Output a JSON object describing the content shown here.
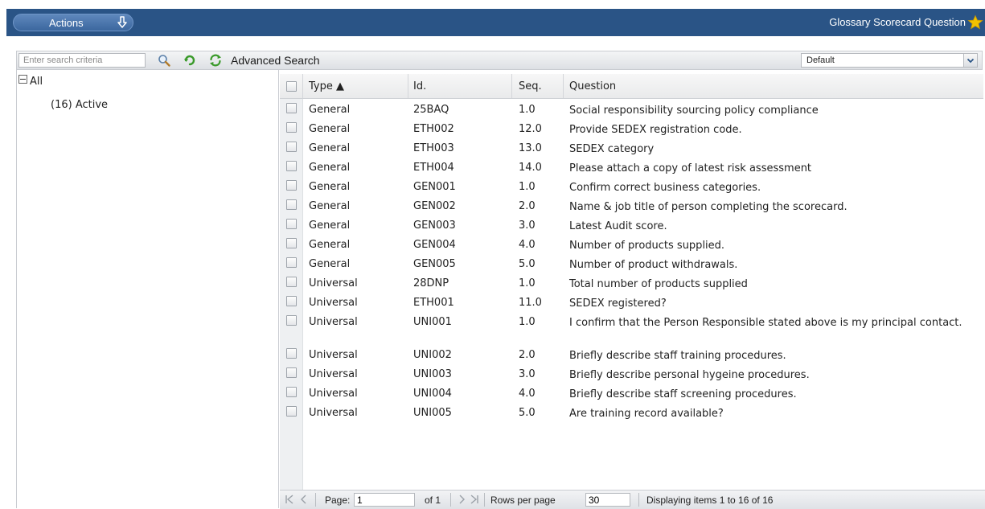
{
  "topbar": {
    "actions_label": "Actions",
    "title": "Glossary Scorecard Question"
  },
  "toolbar": {
    "search_placeholder": "Enter search criteria",
    "advanced_search_label": "Advanced Search",
    "view_selected": "Default"
  },
  "tree": {
    "root_label": "All",
    "active_label": "(16) Active"
  },
  "grid": {
    "headers": {
      "type": "Type ▲",
      "id": "Id.",
      "seq": "Seq.",
      "question": "Question"
    },
    "rows": [
      {
        "type": "General",
        "id": "25BAQ",
        "seq": "1.0",
        "question": "Social responsibility sourcing policy compliance"
      },
      {
        "type": "General",
        "id": "ETH002",
        "seq": "12.0",
        "question": "Provide SEDEX registration code."
      },
      {
        "type": "General",
        "id": "ETH003",
        "seq": "13.0",
        "question": "SEDEX category"
      },
      {
        "type": "General",
        "id": "ETH004",
        "seq": "14.0",
        "question": "Please attach a copy of latest risk assessment"
      },
      {
        "type": "General",
        "id": "GEN001",
        "seq": "1.0",
        "question": "Confirm correct business categories."
      },
      {
        "type": "General",
        "id": "GEN002",
        "seq": "2.0",
        "question": "Name & job title of person completing the scorecard."
      },
      {
        "type": "General",
        "id": "GEN003",
        "seq": "3.0",
        "question": "Latest Audit score."
      },
      {
        "type": "General",
        "id": "GEN004",
        "seq": "4.0",
        "question": "Number of products supplied."
      },
      {
        "type": "General",
        "id": "GEN005",
        "seq": "5.0",
        "question": "Number of product withdrawals."
      },
      {
        "type": "Universal",
        "id": "28DNP",
        "seq": "1.0",
        "question": "Total number of products supplied"
      },
      {
        "type": "Universal",
        "id": "ETH001",
        "seq": "11.0",
        "question": "SEDEX registered?"
      },
      {
        "type": "Universal",
        "id": "UNI001",
        "seq": "1.0",
        "question": "I confirm that the Person Responsible stated above is my principal contact."
      },
      {
        "type": "Universal",
        "id": "UNI002",
        "seq": "2.0",
        "question": "Briefly describe staff training procedures."
      },
      {
        "type": "Universal",
        "id": "UNI003",
        "seq": "3.0",
        "question": "Briefly describe personal hygeine procedures."
      },
      {
        "type": "Universal",
        "id": "UNI004",
        "seq": "4.0",
        "question": "Briefly describe staff screening procedures."
      },
      {
        "type": "Universal",
        "id": "UNI005",
        "seq": "5.0",
        "question": "Are training record available?"
      }
    ]
  },
  "pager": {
    "page_label": "Page:",
    "page_value": "1",
    "of_label": "of 1",
    "rows_label": "Rows per page",
    "rows_value": "30",
    "display_text": "Displaying items 1 to 16 of 16"
  },
  "colors": {
    "topbar": "#2a5486",
    "accent_green": "#3a9a2a",
    "star": "#f2c200"
  }
}
